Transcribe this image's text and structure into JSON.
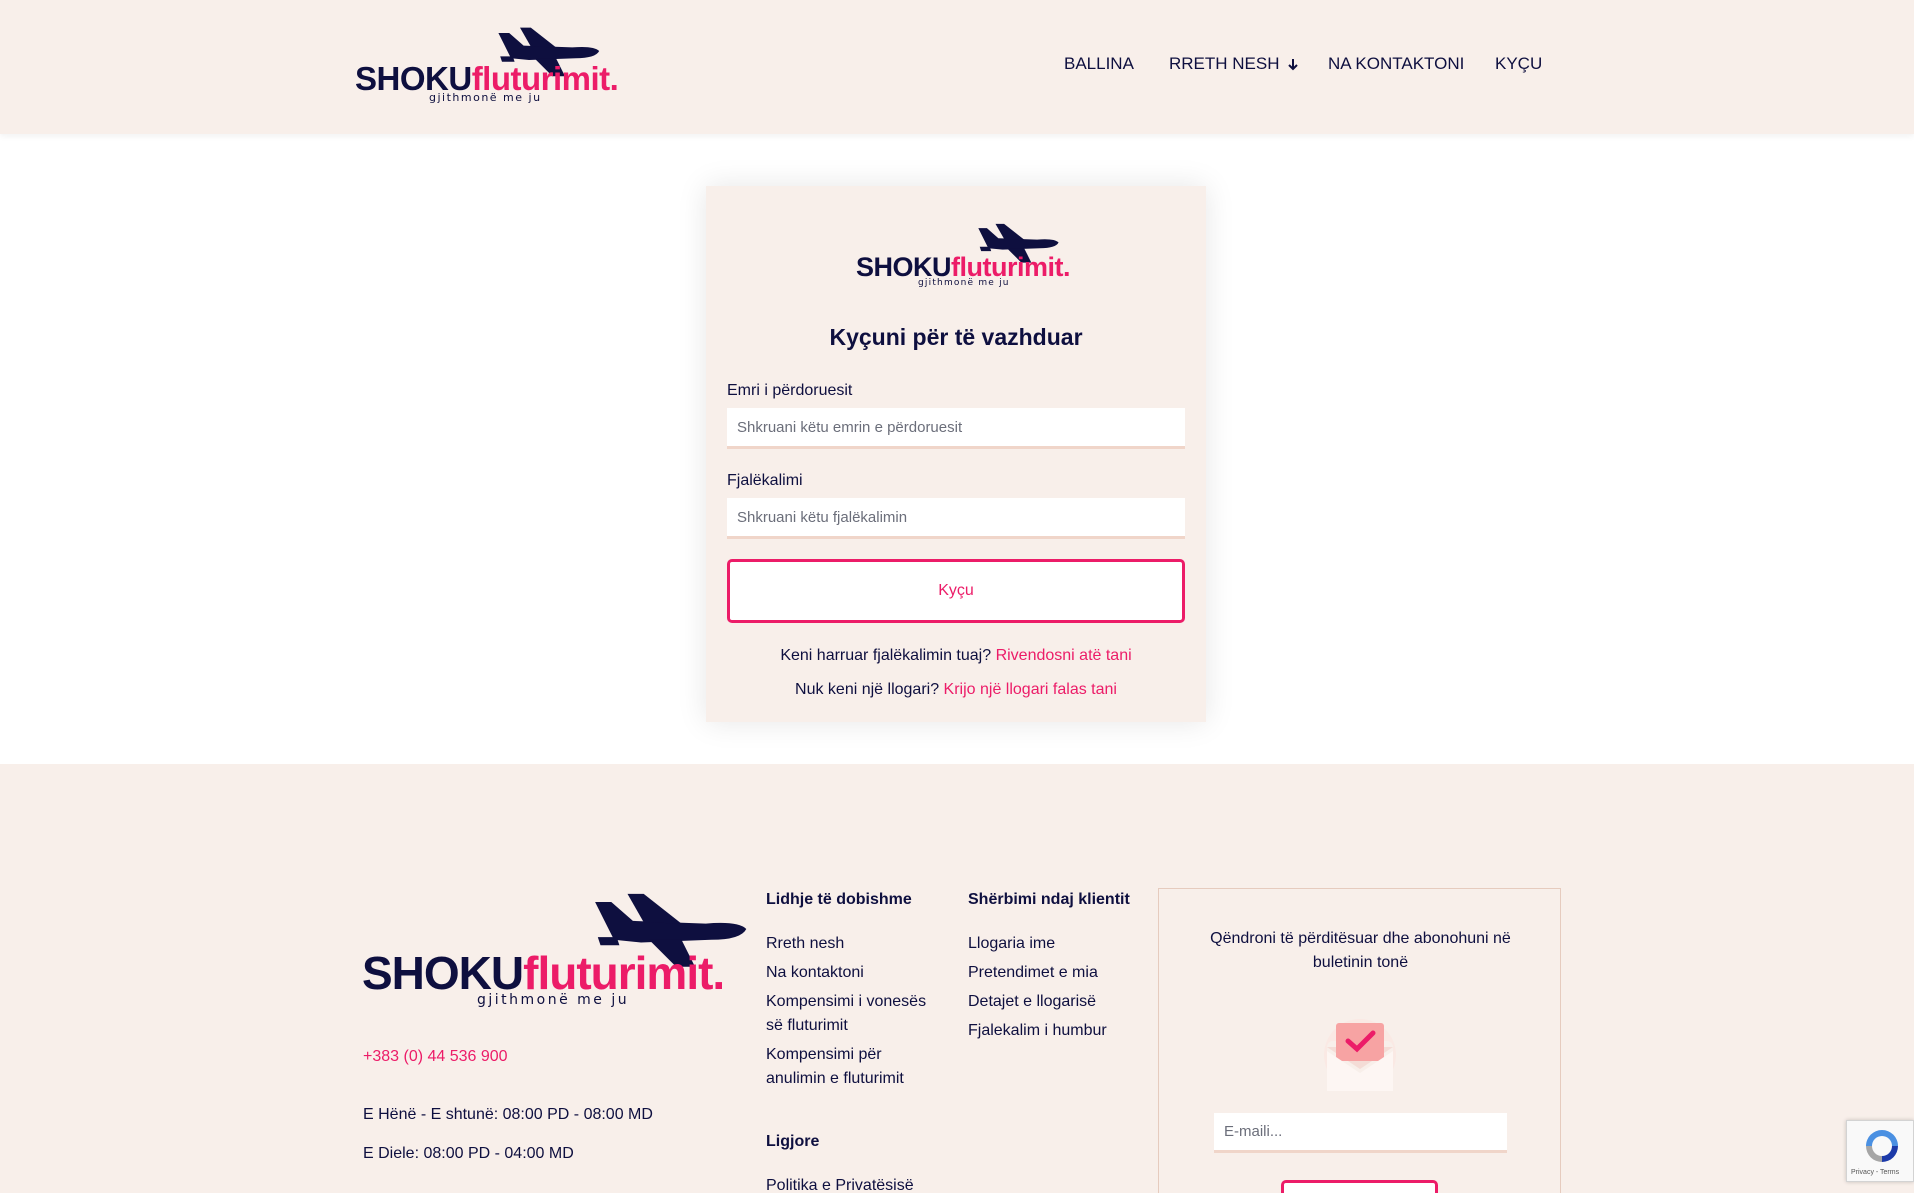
{
  "brand": {
    "name_part1": "SHOKU",
    "name_part2": "fluturimit.",
    "tagline": "gjithmonë me ju",
    "colors": {
      "navy": "#0e0f3f",
      "pink": "#ec1c68",
      "cream": "#f8efea"
    }
  },
  "nav": {
    "items": [
      {
        "label": "BALLINA"
      },
      {
        "label": "RRETH NESH",
        "icon": "chevron-down-icon"
      },
      {
        "label": "NA KONTAKTONI"
      },
      {
        "label": "KYÇU"
      }
    ]
  },
  "login": {
    "title": "Kyçuni për të vazhduar",
    "username_label": "Emri i përdoruesit",
    "username_placeholder": "Shkruani këtu emrin e përdoruesit",
    "username_value": "",
    "password_label": "Fjalëkalimi",
    "password_placeholder": "Shkruani këtu fjalëkalimin",
    "password_value": "",
    "submit_label": "Kyçu",
    "forgot_text": "Keni harruar fjalëkalimin tuaj?",
    "forgot_link": "Rivendosni atë tani",
    "register_text": "Nuk keni një llogari?",
    "register_link": "Krijo një llogari falas tani"
  },
  "footer": {
    "phone": "+383 (0) 44 536 900",
    "hours": [
      "E Hënë - E shtunë: 08:00 PD - 08:00 MD",
      "E Diele: 08:00 PD - 04:00 MD"
    ],
    "useful_links": {
      "title": "Lidhje të dobishme",
      "items": [
        "Rreth nesh",
        "Na kontaktoni",
        "Kompensimi i vonesës së fluturimit",
        "Kompensimi për anulimin e fluturimit"
      ]
    },
    "customer_service": {
      "title": "Shërbimi ndaj klientit",
      "items": [
        "Llogaria ime",
        "Pretendimet e mia",
        "Detajet e llogarisë",
        "Fjalekalim i humbur"
      ]
    },
    "legal": {
      "title": "Ligjore",
      "items": [
        "Politika e Privatësisë"
      ]
    },
    "newsletter": {
      "title": "Qëndroni të përditësuar dhe abonohuni në buletinin tonë",
      "email_placeholder": "E-maili...",
      "icon": "envelope-check-icon"
    }
  },
  "recaptcha": {
    "text": "Privacy - Terms",
    "icon": "recaptcha-icon"
  }
}
